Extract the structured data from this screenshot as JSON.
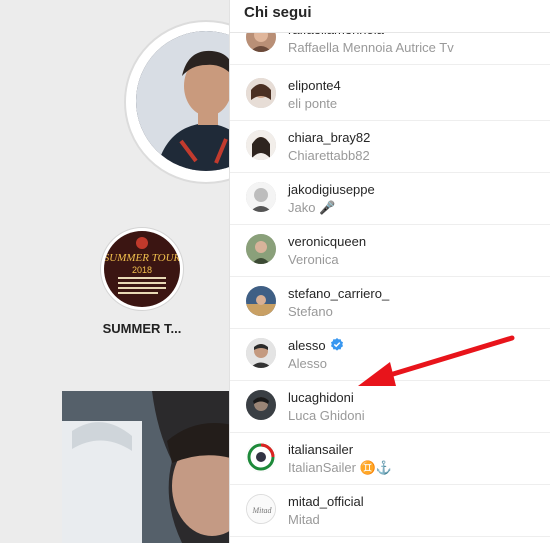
{
  "modal": {
    "title": "Chi segui"
  },
  "highlight": {
    "label": "SUMMER T..."
  },
  "following": [
    {
      "username": "raffaellamennoia",
      "full_name": "Raffaella Mennoia Autrice Tv"
    },
    {
      "username": "eliponte4",
      "full_name": "eli ponte"
    },
    {
      "username": "chiara_bray82",
      "full_name": "Chiarettabb82"
    },
    {
      "username": "jakodigiuseppe",
      "full_name": "Jako 🎤"
    },
    {
      "username": "veronicqueen",
      "full_name": "Veronica"
    },
    {
      "username": "stefano_carriero_",
      "full_name": "Stefano"
    },
    {
      "username": "alesso",
      "full_name": "Alesso",
      "verified": true
    },
    {
      "username": "lucaghidoni",
      "full_name": "Luca Ghidoni"
    },
    {
      "username": "italiansailer",
      "full_name": "ItalianSailer ♊⚓"
    },
    {
      "username": "mitad_official",
      "full_name": "Mitad"
    }
  ],
  "colors": {
    "verified": "#3897f0",
    "arrow": "#e8141b",
    "divider": "#eeeeee"
  }
}
